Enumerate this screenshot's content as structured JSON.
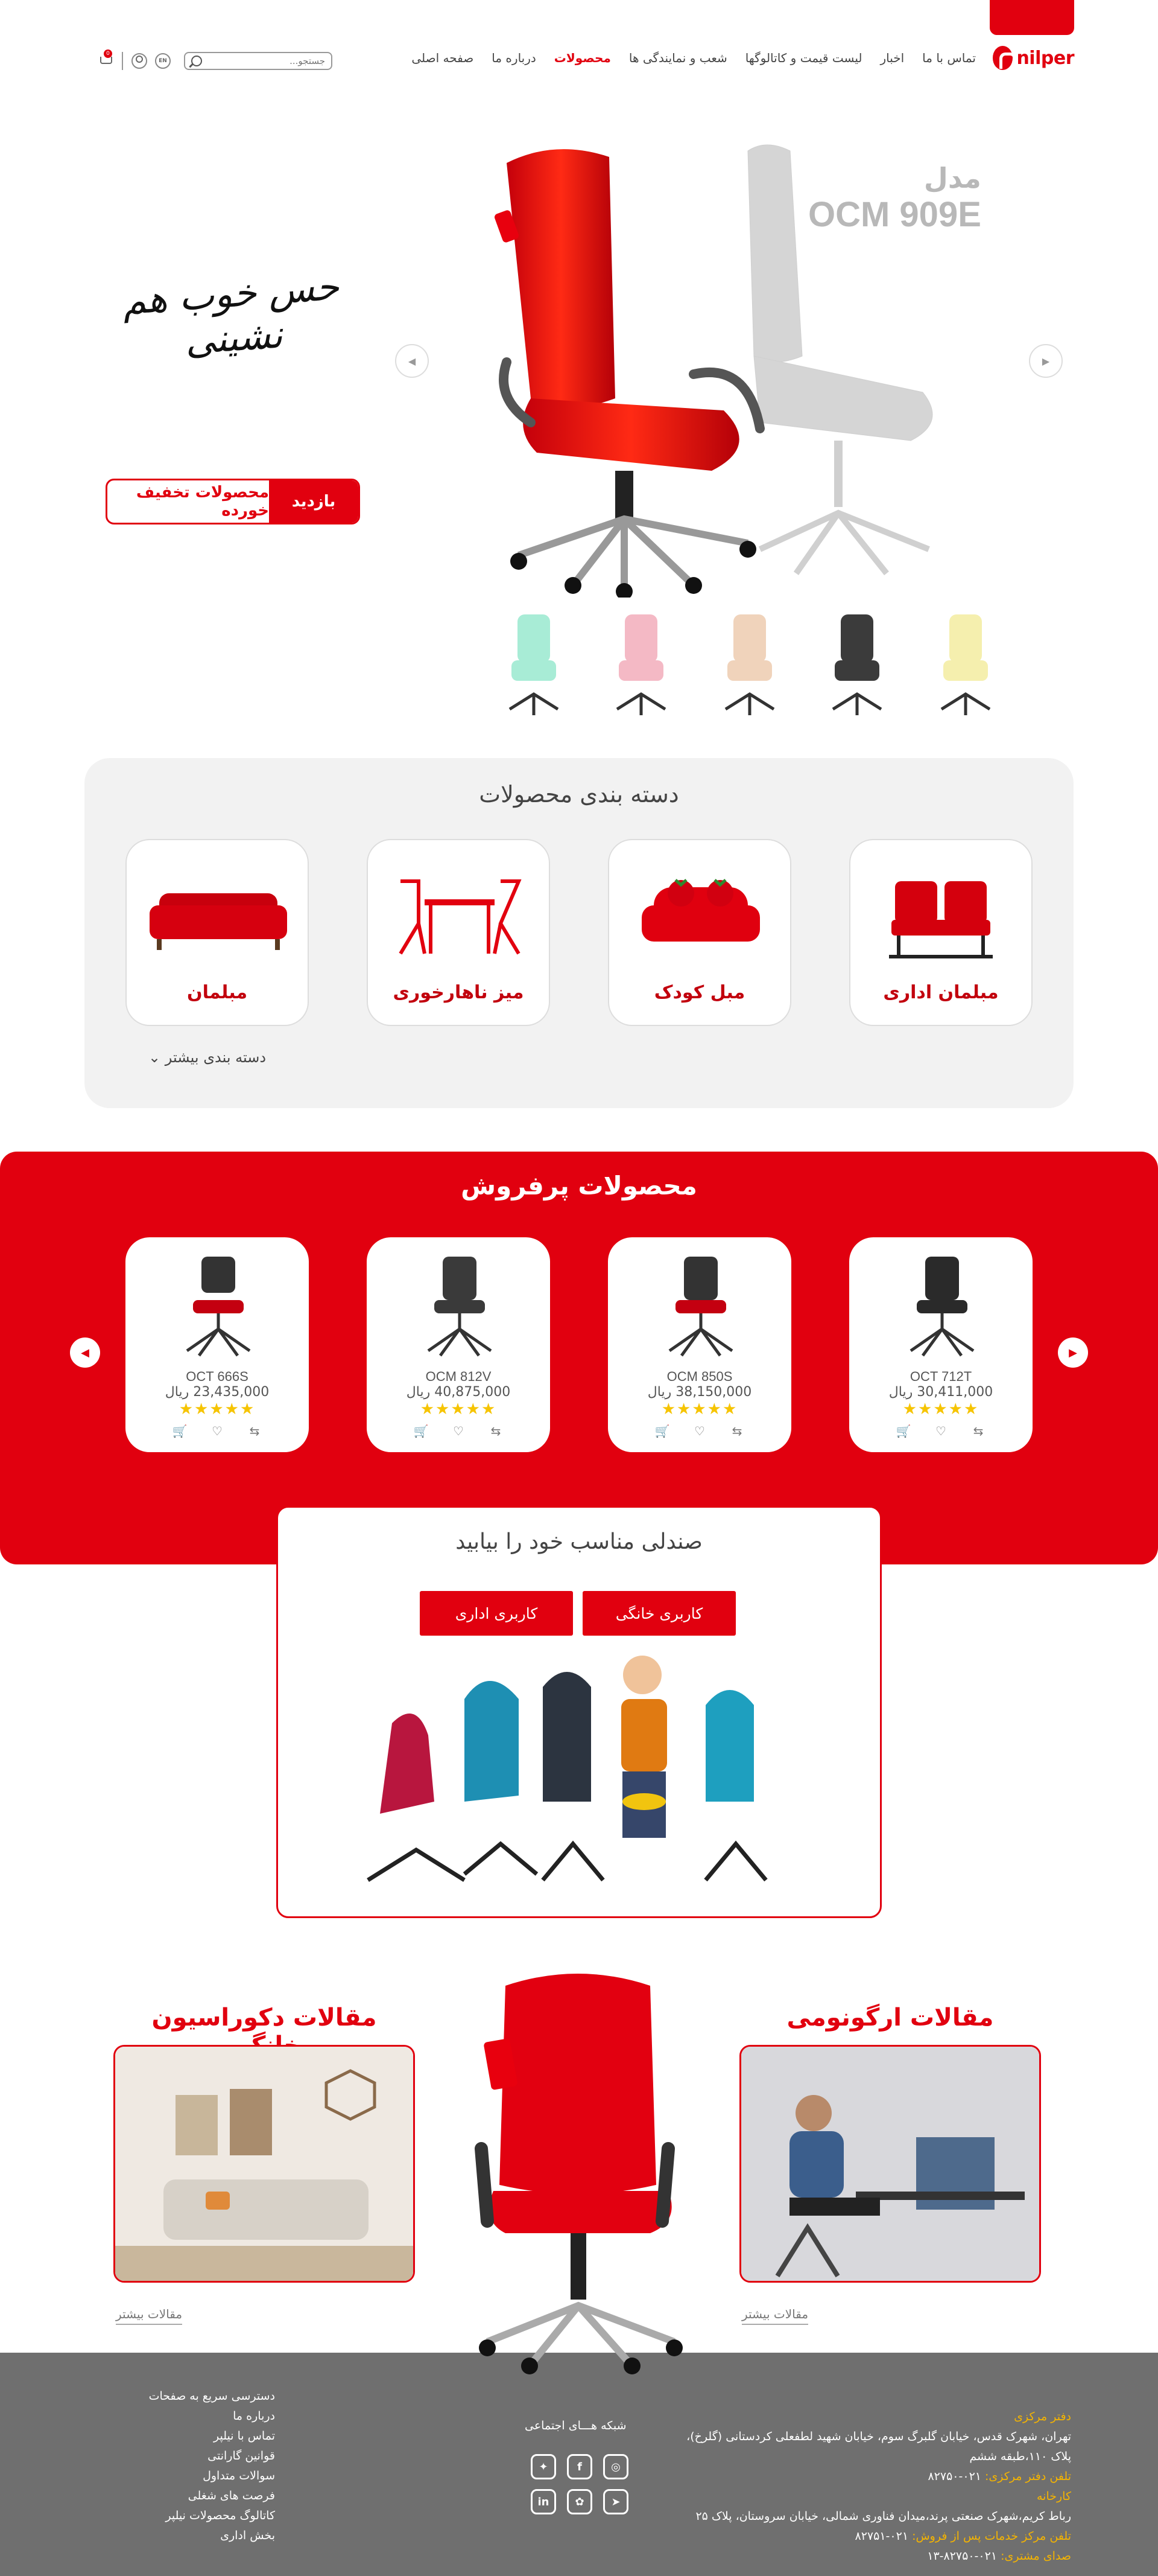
{
  "header": {
    "logo": "nilper",
    "nav": [
      "صفحه اصلی",
      "درباره ما",
      "محصولات",
      "شعب و نمایندگی ها",
      "لیست قیمت و کاتالوگها",
      "اخبار",
      "تماس با ما"
    ],
    "active_nav": "محصولات",
    "search_placeholder": "جستجو...",
    "lang": "EN",
    "cart_count": "0"
  },
  "hero": {
    "model_label": "مدل",
    "model_code": "OCM 909E",
    "slogan": "حس خوب هم نشینی",
    "discount_label": "محصولات تخفیف خورده",
    "discount_action": "بازدید",
    "swatch_colors": [
      "#f5efae",
      "#3b3b3b",
      "#f0d3bb",
      "#f4b9c5",
      "#a8ecd6"
    ]
  },
  "categories": {
    "title": "دسته بندی محصولات",
    "items": [
      "مبلمان اداری",
      "مبل کودک",
      "میز ناهارخوری",
      "مبلمان"
    ],
    "more": "دسته بندی بیشتر"
  },
  "best_sellers": {
    "title": "محصولات پرفروش",
    "products": [
      {
        "model": "OCT 712T",
        "price": "30,411,000 ریال",
        "seat": "#2a2a2a"
      },
      {
        "model": "OCM 850S",
        "price": "38,150,000 ریال",
        "seat": "#c40010"
      },
      {
        "model": "OCM 812V",
        "price": "40,875,000 ریال",
        "seat": "#3a3a3a"
      },
      {
        "model": "OCT 666S",
        "price": "23,435,000 ریال",
        "seat": "#c40010"
      }
    ],
    "stars": "★★★★★"
  },
  "finder": {
    "title": "صندلی مناسب خود را بیابید",
    "home_btn": "کاربری خانگی",
    "office_btn": "کاربری اداری"
  },
  "articles": {
    "ergonomics_title": "مقالات ارگونومی",
    "decoration_title": "مقالات دکوراسیون خانگی",
    "more_ergonomics": "مقالات بیشتر",
    "more_decoration": "مقالات بیشتر"
  },
  "footer": {
    "hq_label": "دفتر مرکزی",
    "hq_address_1": "تهران، شهرک قدس، خیابان گلبرگ سوم، خیابان شهید لطفعلی کردستانی (گلرخ)،",
    "hq_address_2": "پلاک ۱۱۰،طبقه ششم",
    "hq_phone_label": "تلفن دفتر مرکزی:",
    "hq_phone": "۰۲۱-۸۲۷۵۰",
    "factory_label": "کارخانه",
    "factory_address": "رباط کریم،شهرک صنعتی پرند،میدان فناوری شمالی، خیابان سروستان، پلاک ۲۵",
    "service_label": "تلفن مرکز خدمات پس از فروش:",
    "service_phone": "۰۲۱-۸۲۷۵۱",
    "voice_label": "صدای مشتری:",
    "voice_phone": "۰۲۱-۸۲۷۵۰-۱۳",
    "social_title": "شبکه هـــای اجتماعی",
    "quick_title": "دسترسی سریع به صفحات",
    "quick_links": [
      "درباره ما",
      "تماس با نیلپر",
      "قوانین گارانتی",
      "سوالات متداول",
      "فرصت های شغلی",
      "کاتالوگ محصولات نیلپر",
      "بخش اداری"
    ]
  }
}
